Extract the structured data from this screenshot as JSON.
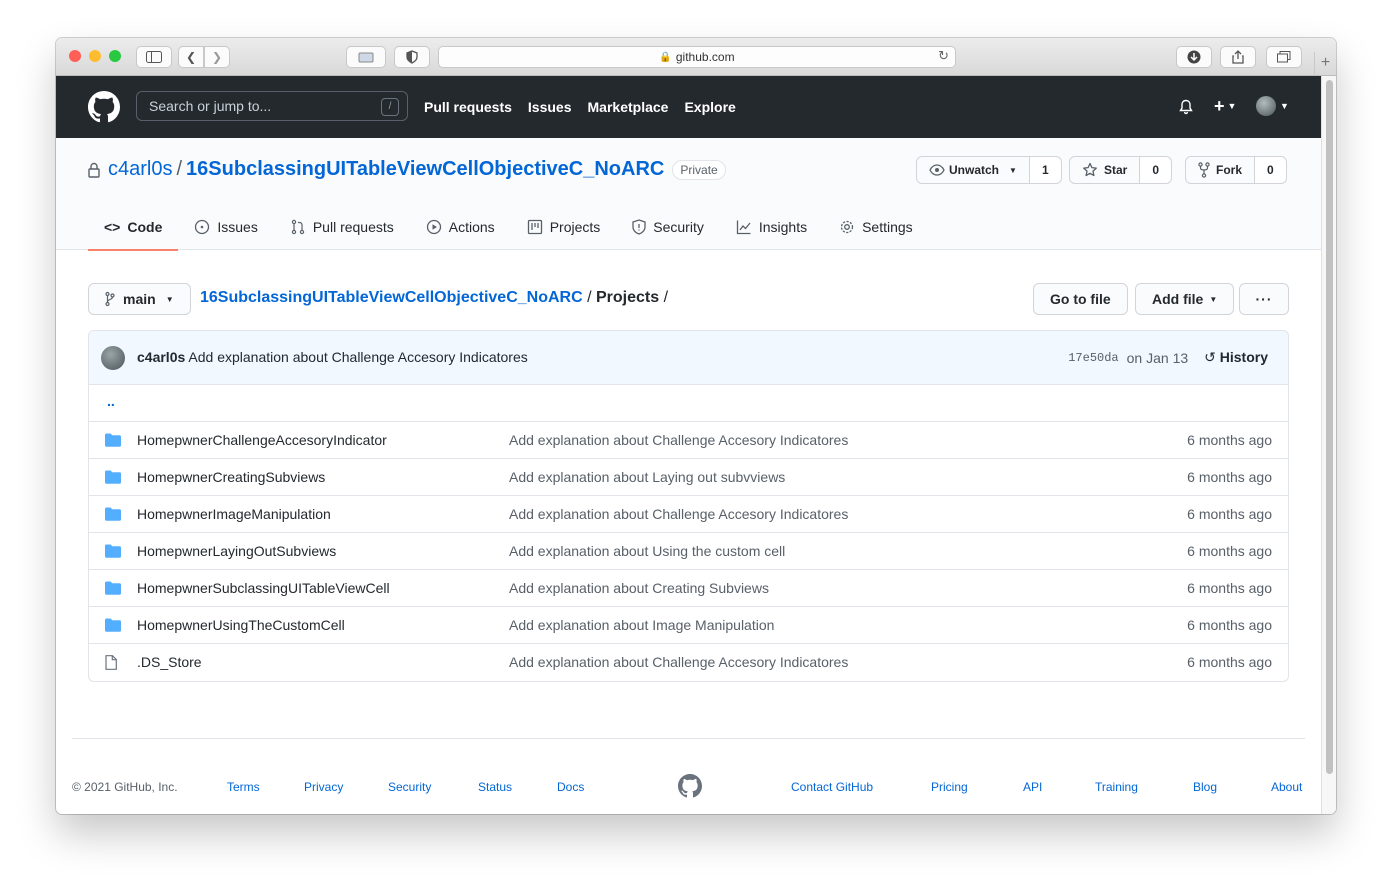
{
  "browser": {
    "url": "github.com",
    "colors": {
      "close": "#ff5f57",
      "minimize": "#febc2e",
      "maximize": "#28c840"
    }
  },
  "header": {
    "search_placeholder": "Search or jump to...",
    "search_shortcut": "/",
    "nav": [
      "Pull requests",
      "Issues",
      "Marketplace",
      "Explore"
    ],
    "plus": "+",
    "icons": [
      "github-logo-icon",
      "bell-icon",
      "plus-icon",
      "avatar"
    ]
  },
  "repo": {
    "owner": "c4arl0s",
    "separator": "/",
    "name": "16SubclassingUITableViewCellObjectiveC_NoARC",
    "visibility": "Private",
    "unwatch_label": "Unwatch",
    "unwatch_count": "1",
    "star_label": "Star",
    "star_count": "0",
    "fork_label": "Fork",
    "fork_count": "0",
    "tabs": [
      "Code",
      "Issues",
      "Pull requests",
      "Actions",
      "Projects",
      "Security",
      "Insights",
      "Settings"
    ],
    "active_tab": "Code"
  },
  "breadcrumb": {
    "branch": "main",
    "repo_link": "16SubclassingUITableViewCellObjectiveC_NoARC",
    "separator": " / ",
    "folder": "Projects",
    "trailing": " /"
  },
  "actions": {
    "go_to_file": "Go to file",
    "add_file": "Add file",
    "more": "···"
  },
  "commit": {
    "author": "c4arl0s",
    "message": "Add explanation about Challenge Accesory Indicatores",
    "sha": "17e50da",
    "date": "on Jan 13",
    "history_label": "History"
  },
  "parent_dir": "..",
  "files": [
    {
      "name": "HomepwnerChallengeAccesoryIndicator",
      "type": "dir",
      "message": "Add explanation about Challenge Accesory Indicatores",
      "age": "6 months ago"
    },
    {
      "name": "HomepwnerCreatingSubviews",
      "type": "dir",
      "message": "Add explanation about Laying out subvviews",
      "age": "6 months ago"
    },
    {
      "name": "HomepwnerImageManipulation",
      "type": "dir",
      "message": "Add explanation about Challenge Accesory Indicatores",
      "age": "6 months ago"
    },
    {
      "name": "HomepwnerLayingOutSubviews",
      "type": "dir",
      "message": "Add explanation about Using the custom cell",
      "age": "6 months ago"
    },
    {
      "name": "HomepwnerSubclassingUITableViewCell",
      "type": "dir",
      "message": "Add explanation about Creating Subviews",
      "age": "6 months ago"
    },
    {
      "name": "HomepwnerUsingTheCustomCell",
      "type": "dir",
      "message": "Add explanation about Image Manipulation",
      "age": "6 months ago"
    },
    {
      "name": ".DS_Store",
      "type": "file",
      "message": "Add explanation about Challenge Accesory Indicatores",
      "age": "6 months ago"
    }
  ],
  "footer": {
    "copyright": "© 2021 GitHub, Inc.",
    "links": [
      "Terms",
      "Privacy",
      "Security",
      "Status",
      "Docs",
      "Contact GitHub",
      "Pricing",
      "API",
      "Training",
      "Blog",
      "About"
    ]
  },
  "theme": {
    "link": "#0366d6",
    "header_bg": "#24292e",
    "folder": "#54aeff",
    "tab_underline": "#f9826c"
  }
}
